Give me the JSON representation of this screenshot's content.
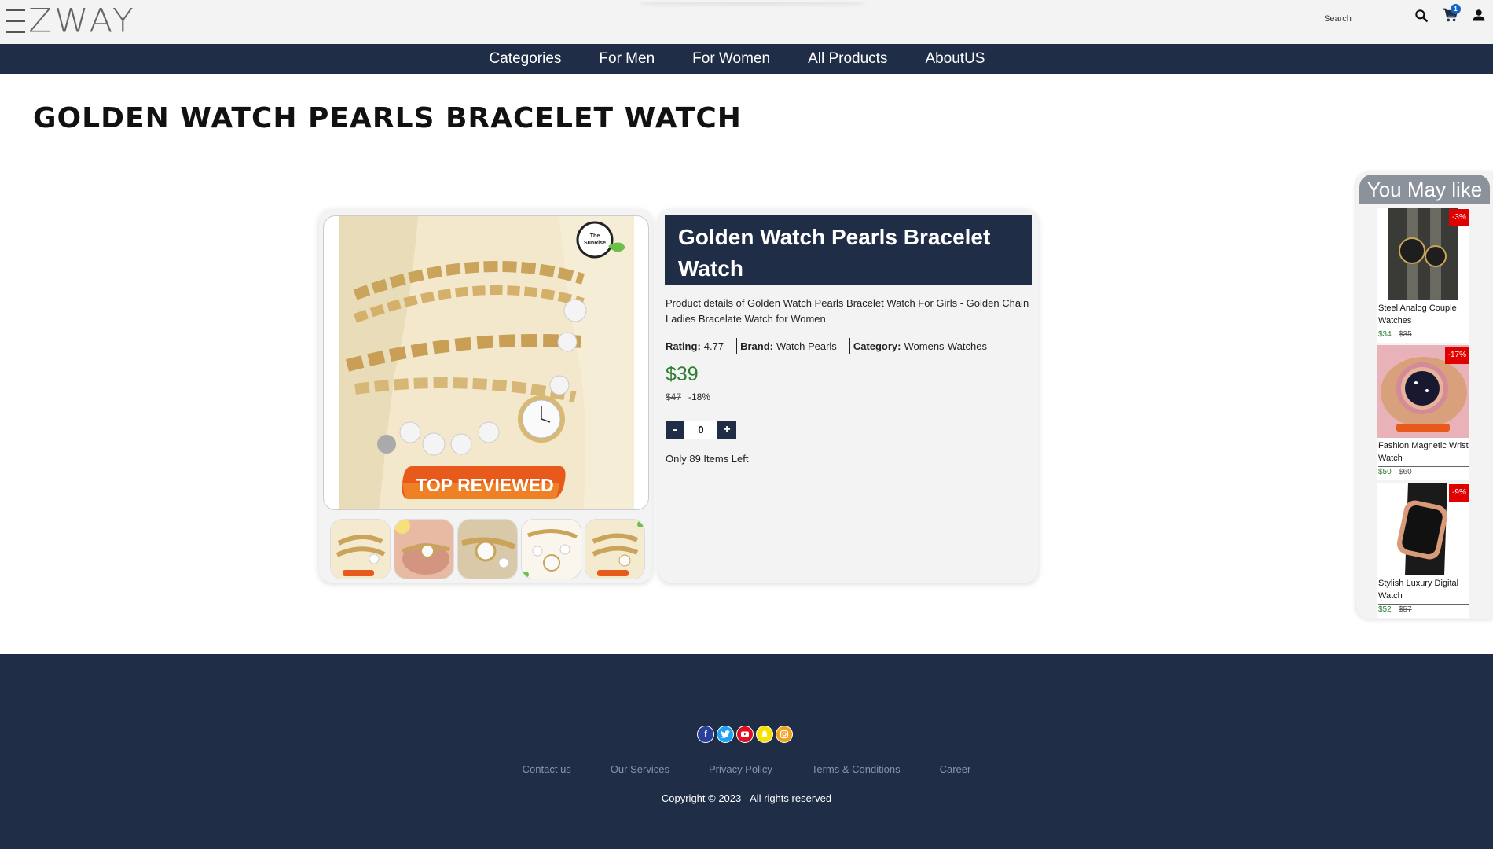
{
  "header": {
    "logo_text": "ZWAY",
    "search_placeholder": "Search",
    "cart_count": "1"
  },
  "nav": {
    "items": [
      "Categories",
      "For Men",
      "For Women",
      "All Products",
      "AboutUS"
    ]
  },
  "page": {
    "title": "GOLDEN WATCH PEARLS BRACELET WATCH"
  },
  "product": {
    "name": "Golden Watch Pearls Bracelet Watch",
    "description": "Product details of Golden Watch Pearls Bracelet Watch For Girls - Golden Chain Ladies Bracelate Watch for Women",
    "rating_label": "Rating:",
    "rating": "4.77",
    "brand_label": "Brand:",
    "brand": "Watch Pearls",
    "category_label": "Category:",
    "category": "Womens-Watches",
    "price": "$39",
    "old_price": "$47",
    "discount": "-18%",
    "qty_minus": "-",
    "qty_value": "0",
    "qty_plus": "+",
    "stock_text": "Only 89 Items Left",
    "image_badge": "TOP REVIEWED",
    "image_logo_line1": "The",
    "image_logo_line2": "SunRise"
  },
  "sidebar": {
    "title": "You May like",
    "items": [
      {
        "name": "Steel Analog Couple Watches",
        "price": "$34",
        "old_price": "$35",
        "badge": "-3%"
      },
      {
        "name": "Fashion Magnetic Wrist Watch",
        "price": "$50",
        "old_price": "$60",
        "badge": "-17%"
      },
      {
        "name": "Stylish Luxury Digital Watch",
        "price": "$52",
        "old_price": "$57",
        "badge": "-9%"
      }
    ]
  },
  "footer": {
    "links": [
      "Contact us",
      "Our Services",
      "Privacy Policy",
      "Terms & Conditions",
      "Career"
    ],
    "copyright": "Copyright © 2023 - All rights reserved",
    "social_icons": [
      "facebook-icon",
      "twitter-icon",
      "youtube-icon",
      "snapchat-icon",
      "instagram-icon"
    ]
  },
  "colors": {
    "navy": "#1f2d47",
    "price_green": "#2e7d32",
    "badge_red": "#e00000",
    "cart_badge_blue": "#1565c0"
  }
}
